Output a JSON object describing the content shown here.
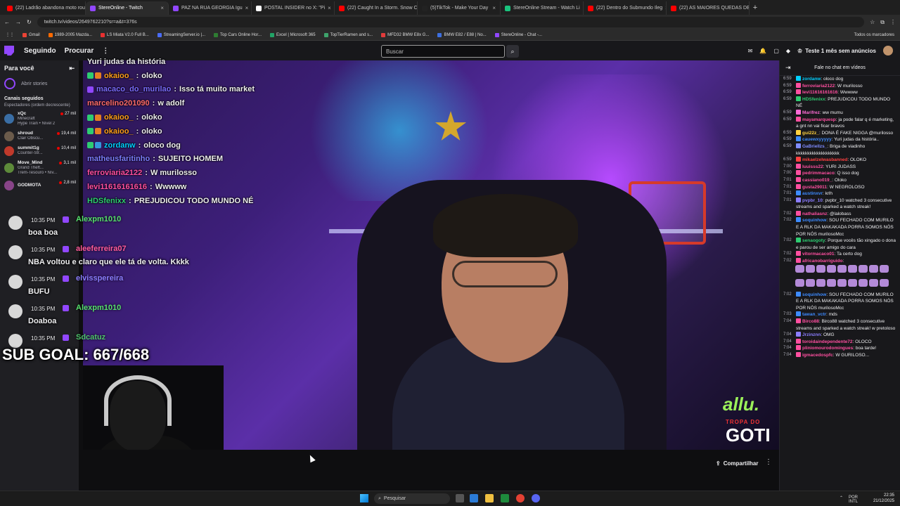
{
  "browser": {
    "tabs": [
      {
        "label": "(22) Ladrão abandona moto rou",
        "color": "#ff0000"
      },
      {
        "label": "StereOnline - Twitch",
        "color": "#9147ff"
      },
      {
        "label": "PAZ NA RUA GEORGIA Igu",
        "color": "#9147ff"
      },
      {
        "label": "POSTAL INSIDER no X: \"Pi",
        "color": "#ffffff"
      },
      {
        "label": "(22) Caught In a Storm. Snow C",
        "color": "#ff0000"
      },
      {
        "label": "(5)TikTok - Make Your Day",
        "color": "#222222"
      },
      {
        "label": "StereOnline Stream - Watch Li",
        "color": "#19c37d"
      },
      {
        "label": "(22) Dentro do Submundo Ileg",
        "color": "#ff0000"
      },
      {
        "label": "(22) AS MAIORES QUEDAS DE",
        "color": "#ff0000"
      }
    ],
    "url": "twitch.tv/videos/2649762210?sr=a&t=376s",
    "bookmarks": [
      "Gmail",
      "1989-2005 Mazda...",
      "LS Miata V2.0 Full B...",
      "StreamingServer.io |...",
      "Top Cars Online Hor...",
      "Excel | Microsoft 365",
      "TopTierRamen and s...",
      "MFD32 BMW E8x G...",
      "BMW E82 / E88 | No...",
      "StereOnline - Chat -..."
    ],
    "bookmarks_right": "Todos os marcadores"
  },
  "topnav": {
    "following": "Seguindo",
    "browse": "Procurar",
    "more": "⋮",
    "search_placeholder": "Buscar",
    "promo": "Teste 1 mês sem anúncios"
  },
  "sidebar": {
    "title": "Para você",
    "stories": "Abrir stories",
    "section": "Canais seguidos",
    "sort": "Espectadores (ordem decrescente)",
    "channels": [
      {
        "name": "xQc",
        "game": "Minecraft",
        "sub": "Hype Train • Nível 2",
        "viewers": "27 mil",
        "color": "#3a6ea5"
      },
      {
        "name": "shroud",
        "game": "Clair Obscu...",
        "viewers": "19,4 mil",
        "color": "#6b5b4b"
      },
      {
        "name": "summit1g",
        "game": "Counter-Str...",
        "viewers": "10,4 mil",
        "color": "#c0392b"
      },
      {
        "name": "Move_Mind",
        "game": "Grand Theft...",
        "sub": "Trem-Tesouro • Nív...",
        "viewers": "3,1 mil",
        "color": "#5d8a3a"
      },
      {
        "name": "GODMOTA",
        "game": "",
        "viewers": "2,8 mil",
        "color": "#884488"
      }
    ]
  },
  "overlay_chat": [
    {
      "user": "",
      "text": "Yuri judas da história",
      "color": "#ffffff",
      "badges": []
    },
    {
      "user": "okaioo_",
      "text": "oloko",
      "color": "#ff9f1a",
      "badges": [
        "#2ecc71",
        "#e67e22"
      ]
    },
    {
      "user": "macaco_do_murilao",
      "text": "Isso tá muito market",
      "color": "#7b6bff",
      "badges": [
        "#9147ff"
      ]
    },
    {
      "user": "marcelino201090",
      "text": "w adolf",
      "color": "#ff6b6b",
      "badges": []
    },
    {
      "user": "okaioo_",
      "text": "oloko",
      "color": "#ff9f1a",
      "badges": [
        "#2ecc71",
        "#e67e22"
      ]
    },
    {
      "user": "okaioo_",
      "text": "oloko",
      "color": "#ff9f1a",
      "badges": [
        "#2ecc71",
        "#e67e22"
      ]
    },
    {
      "user": "zordanw",
      "text": "oloco dog",
      "color": "#00d0ff",
      "badges": [
        "#2ecc71",
        "#3498db"
      ]
    },
    {
      "user": "matheusfaritinho",
      "text": "SUJEITO HOMEM",
      "color": "#7d7dff",
      "badges": []
    },
    {
      "user": "ferroviaria2122",
      "text": "W murilosso",
      "color": "#ff4fa0",
      "badges": []
    },
    {
      "user": "levi11616161616",
      "text": "Wwwww",
      "color": "#ff4fa0",
      "badges": []
    },
    {
      "user": "HDSfenixx",
      "text": "PREJUDICOU TODO MUNDO NÉ",
      "color": "#2ecc71",
      "badges": []
    }
  ],
  "overlay_events": [
    {
      "time": "10:35 PM",
      "user": "Alexpm1010",
      "text": "boa boa",
      "color": "#55e06b"
    },
    {
      "time": "10:35 PM",
      "user": "aleeferreira07",
      "text": "NBA voltou e claro que ele tá de volta. Kkkk",
      "color": "#ff5a9a"
    },
    {
      "time": "10:35 PM",
      "user": "elvisspereira",
      "text": "BUFU",
      "color": "#8b7dff"
    },
    {
      "time": "10:35 PM",
      "user": "Alexpm1010",
      "text": "Doaboa",
      "color": "#55e06b"
    },
    {
      "time": "10:35 PM",
      "user": "Sdcatuz",
      "text": "",
      "color": "#4ec36b"
    }
  ],
  "sub_goal": "SUB GOAL: 667/668",
  "brand": {
    "allu": "allu.",
    "tropa": "TROPA DO",
    "goti": "GOTI"
  },
  "video_actions": {
    "share": "Compartilhar",
    "more": "⋮"
  },
  "chat": {
    "header": "Fale no chat em vídeos",
    "messages": [
      {
        "time": "6:59",
        "user": "zordanw",
        "text": "oloco dog",
        "color": "#00d0ff"
      },
      {
        "time": "6:59",
        "user": "ferroviaria2122",
        "text": "W murilosso",
        "color": "#ff4fa0"
      },
      {
        "time": "6:59",
        "user": "levi11616161616",
        "text": "Wwwww",
        "color": "#ff4fa0"
      },
      {
        "time": "6:59",
        "user": "HDSfenixx",
        "text": "PREJUDICOU TODO MUNDO NÉ",
        "color": "#2ecc71"
      },
      {
        "time": "6:59",
        "user": "Marifrez",
        "text": "ww mumu",
        "color": "#ff6bd6"
      },
      {
        "time": "6:59",
        "user": "mayamarquesp",
        "text": "ja pode falar q é marketing, a gnt nn vai ficar bravos",
        "color": "#ff4fa0"
      },
      {
        "time": "6:59",
        "user": "gui22z_",
        "text": "DONA É FAKE NIGGA @murilosso",
        "color": "#ffd23f"
      },
      {
        "time": "6:59",
        "user": "cauewxyyyyy",
        "text": "Yuri judas da história..",
        "color": "#3d8bff"
      },
      {
        "time": "6:59",
        "user": "GaBriellzs_",
        "text": "Briga de viadinho kkkkkkkkkkkkkkkkkkk",
        "color": "#7f8cff"
      },
      {
        "time": "6:59",
        "user": "mikaelzelwasbanned",
        "text": "OLOKO",
        "color": "#ff4040"
      },
      {
        "time": "7:00",
        "user": "luuisss22",
        "text": "YURI JUDASS",
        "color": "#ff4fa0"
      },
      {
        "time": "7:00",
        "user": "pedrimmacaco",
        "text": "Q isso dog",
        "color": "#ff4fa0"
      },
      {
        "time": "7:01",
        "user": "cassiano019_",
        "text": "Oloko",
        "color": "#ff4fa0"
      },
      {
        "time": "7:01",
        "user": "gusta29011",
        "text": "W NEGROLOSO",
        "color": "#ff4fa0"
      },
      {
        "time": "7:01",
        "user": "austinxvr",
        "text": "krlh",
        "color": "#3d8bff"
      },
      {
        "time": "7:01",
        "user": "pvpbr_10",
        "text": "pvpbr_10 watched 3 consecutive streams and sparked a watch streak!",
        "color": "#8b7dff"
      },
      {
        "time": "7:02",
        "user": "nathaliasnz",
        "text": "@lalobass",
        "color": "#ff4fa0"
      },
      {
        "time": "7:02",
        "user": "soquinhow",
        "text": "SOU FECHADO COM MURILO E A RLK DA MAKAKADA PORRA SOMOS NÓS POR NÓS murilosoMcc",
        "color": "#3d8bff"
      },
      {
        "time": "7:02",
        "user": "senaogoty",
        "text": "Porque vocês tão xingado o dona e parou de ser amigo do cara",
        "color": "#2ecc71"
      },
      {
        "time": "7:02",
        "user": "vitormacaco01",
        "text": "Ta certo dog",
        "color": "#ff4fa0"
      },
      {
        "time": "7:02",
        "user": "africanobarriguido",
        "text": "",
        "color": "#ff4fa0"
      },
      {
        "time": "7:02",
        "user": "soquinhow",
        "text": "SOU FECHADO COM MURILO E A RLK DA MAKAKADA PORRA SOMOS NÓS POR NÓS murilosoMcc",
        "color": "#3d8bff"
      },
      {
        "time": "7:03",
        "user": "tawan_vctr",
        "text": "mds",
        "color": "#3d8bff"
      },
      {
        "time": "7:04",
        "user": "Birco88",
        "text": "Birco88 watched 3 consecutive streams and sparked a watch streak! w pretoloso",
        "color": "#ff4fa0"
      },
      {
        "time": "7:04",
        "user": "Jrzinznn",
        "text": "OMG",
        "color": "#8b7dff"
      },
      {
        "time": "7:04",
        "user": "toroidaindependente72",
        "text": "OLOCO",
        "color": "#ff4fa0"
      },
      {
        "time": "7:04",
        "user": "pliniomourodomingues",
        "text": "boa tarde!",
        "color": "#ff4fa0"
      },
      {
        "time": "7:04",
        "user": "igmacedospfc",
        "text": "W GURILOSO...",
        "color": "#ff4fa0"
      }
    ]
  },
  "taskbar": {
    "search": "Pesquisar",
    "lang": "POR",
    "lang2": "INTL",
    "time": "22:35",
    "date": "21/12/2025"
  }
}
